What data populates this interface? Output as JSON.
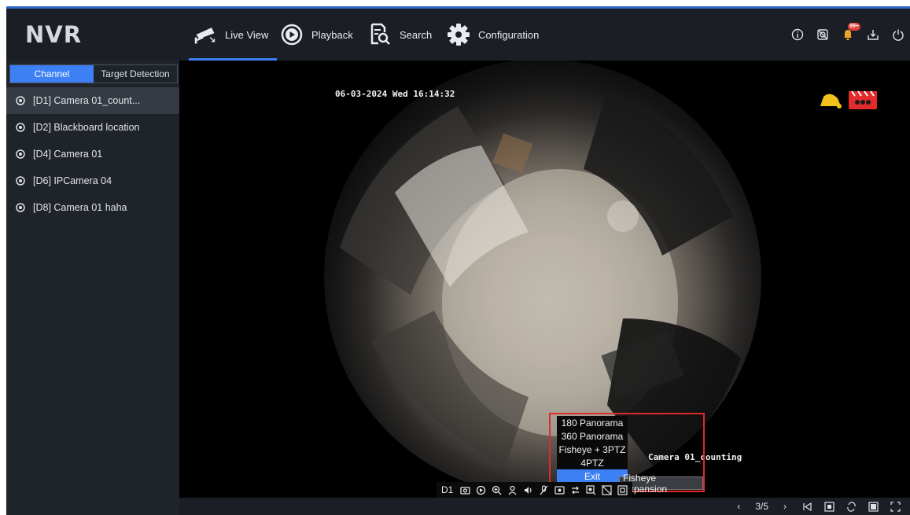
{
  "app": {
    "logo": "NVR"
  },
  "nav": [
    {
      "label": "Live View",
      "icon": "cctv-camera-icon",
      "active": true
    },
    {
      "label": "Playback",
      "icon": "playback-icon"
    },
    {
      "label": "Search",
      "icon": "search-file-icon"
    },
    {
      "label": "Configuration",
      "icon": "gear-icon"
    }
  ],
  "top_right": {
    "alarm_badge": "99+"
  },
  "sidebar": {
    "tabs": [
      {
        "label": "Channel",
        "active": true
      },
      {
        "label": "Target Detection"
      }
    ],
    "channels": [
      {
        "label": "[D1] Camera 01_count...",
        "selected": true
      },
      {
        "label": "[D2] Blackboard location"
      },
      {
        "label": "[D4] Camera 01"
      },
      {
        "label": "[D6] IPCamera 04"
      },
      {
        "label": "[D8] Camera 01 haha"
      }
    ]
  },
  "video": {
    "timestamp": "06-03-2024 Wed 16:14:32",
    "camera_name": "Camera 01_counting",
    "channel_label": "D1"
  },
  "fisheye_menu": {
    "options": [
      "180 Panorama",
      "360 Panorama",
      "Fisheye + 3PTZ",
      "4PTZ",
      "Exit"
    ],
    "active_option": "Exit",
    "tooltip": "Fisheye Expansion"
  },
  "bottom": {
    "page_indicator": "3/5"
  },
  "colors": {
    "accent": "#3d7ff5",
    "highlight": "#e02b2b",
    "background": "#111418"
  }
}
